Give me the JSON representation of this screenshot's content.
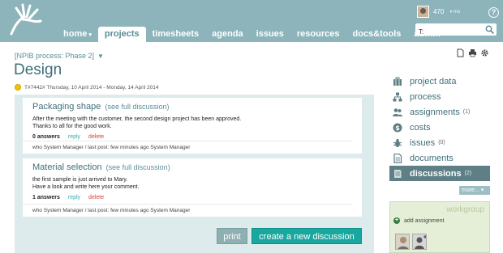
{
  "colors": {
    "header": "#8cb4ba",
    "accent": "#3e6f78",
    "create_button": "#18a8a0",
    "status_dot": "#f2c200"
  },
  "header": {
    "nav": [
      {
        "label": "home",
        "caret": "▾",
        "active": false
      },
      {
        "label": "projects",
        "active": true
      },
      {
        "label": "timesheets",
        "active": false
      },
      {
        "label": "agenda",
        "active": false
      },
      {
        "label": "issues",
        "active": false
      },
      {
        "label": "resources",
        "active": false
      },
      {
        "label": "docs&tools",
        "active": false
      },
      {
        "label": "admin",
        "active": false
      }
    ],
    "user": {
      "score": "470",
      "menu_label": "▾ me"
    },
    "help_label": "?",
    "search": {
      "value": "T:"
    }
  },
  "page": {
    "breadcrumb": "[NPIB process: Phase 2]",
    "breadcrumb_caret": "▼",
    "title": "Design",
    "date_line": "T#7442#  Thursday, 10 April 2014 - Monday, 14 April 2014"
  },
  "discussions": [
    {
      "title": "Packaging shape",
      "see_full": "(see full discussion)",
      "body_line1": "After the meeting with the customer, the second design project has been approved.",
      "body_line2": "Thanks to all for the good work.",
      "answers": "0 answers",
      "reply": "reply",
      "delete": "delete",
      "meta": "who System Manager  /  last post: few minutes ago System Manager"
    },
    {
      "title": "Material selection",
      "see_full": "(see full discussion)",
      "body_line1": "the first sample is just arrived to Mary.",
      "body_line2": "Have a look and write here your comment.",
      "answers": "1 answers",
      "reply": "reply",
      "delete": "delete",
      "meta": "who System Manager  /  last post: few minutes ago System Manager"
    }
  ],
  "buttons": {
    "print": "print",
    "create": "create a new discussion"
  },
  "side_menu": [
    {
      "label": "project data",
      "icon": "briefcase-icon",
      "count": ""
    },
    {
      "label": "process",
      "icon": "process-icon",
      "count": ""
    },
    {
      "label": "assignments",
      "icon": "people-icon",
      "count": "(1)"
    },
    {
      "label": "costs",
      "icon": "coin-icon",
      "count": ""
    },
    {
      "label": "issues",
      "icon": "bug-icon",
      "count": "(0)"
    },
    {
      "label": "documents",
      "icon": "document-icon",
      "count": ""
    },
    {
      "label": "discussions",
      "icon": "discussion-icon",
      "count": "(2)",
      "active": true
    }
  ],
  "more_label": "more... ▾",
  "workgroup": {
    "title": "workgroup",
    "add_label": "add assignment",
    "add_icon": "+"
  }
}
